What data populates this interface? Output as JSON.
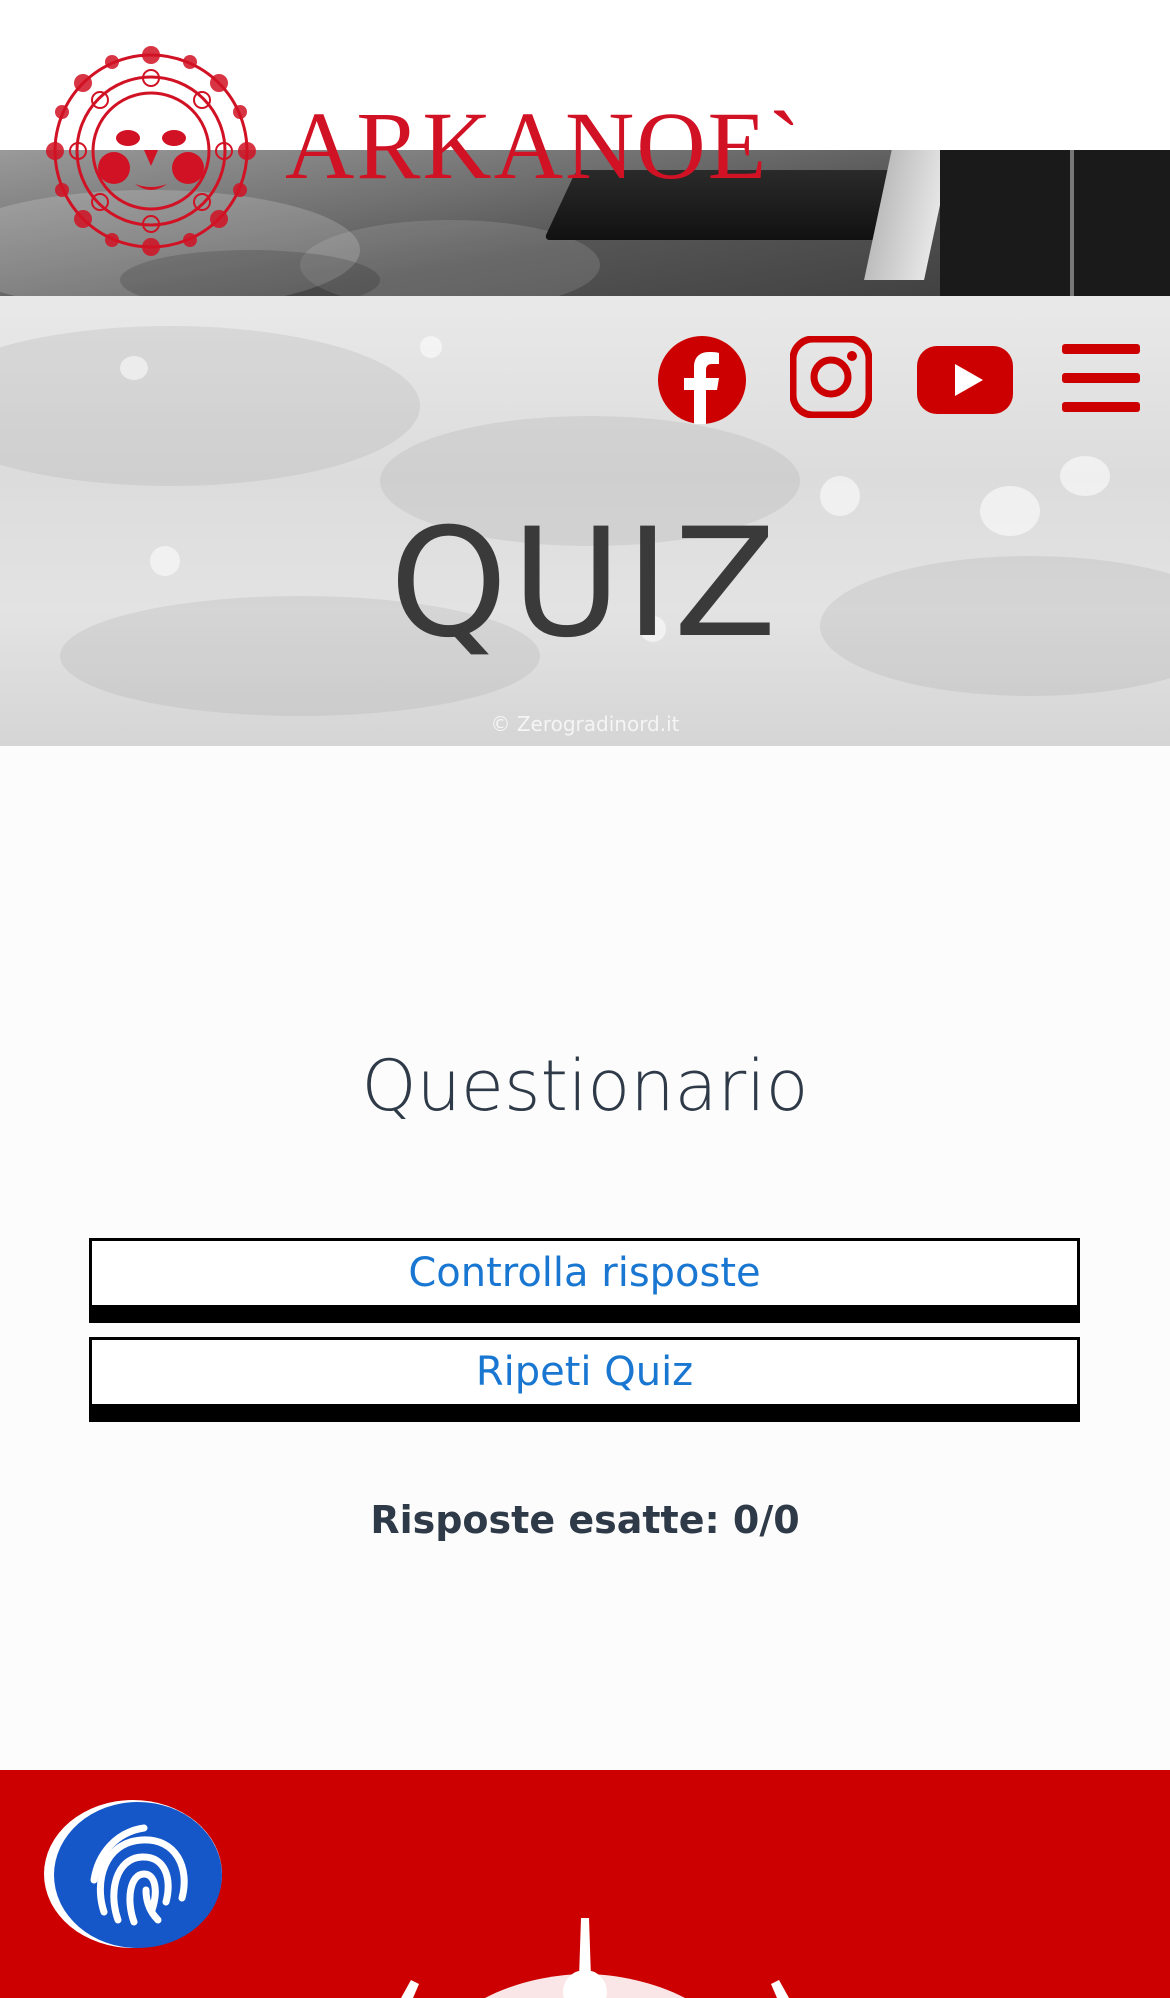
{
  "header": {
    "brand": "ARKANOE`",
    "logo_icon": "sun-face-icon",
    "brand_color": "#d11224"
  },
  "hero": {
    "title": "QUIZ",
    "photo_credit": "© Zerogradinord.it",
    "social": [
      {
        "name": "facebook-icon"
      },
      {
        "name": "instagram-icon"
      },
      {
        "name": "youtube-icon"
      }
    ],
    "menu_icon": "hamburger-menu-icon"
  },
  "quiz": {
    "title": "Questionario",
    "check_label": "Controlla risposte",
    "repeat_label": "Ripeti Quiz",
    "score_text": "Risposte esatte: 0/0",
    "link_color": "#1977d2"
  },
  "footer": {
    "background": "#cc0000",
    "accessibility_icon": "fingerprint-icon",
    "accessibility_color": "#1557c9"
  }
}
